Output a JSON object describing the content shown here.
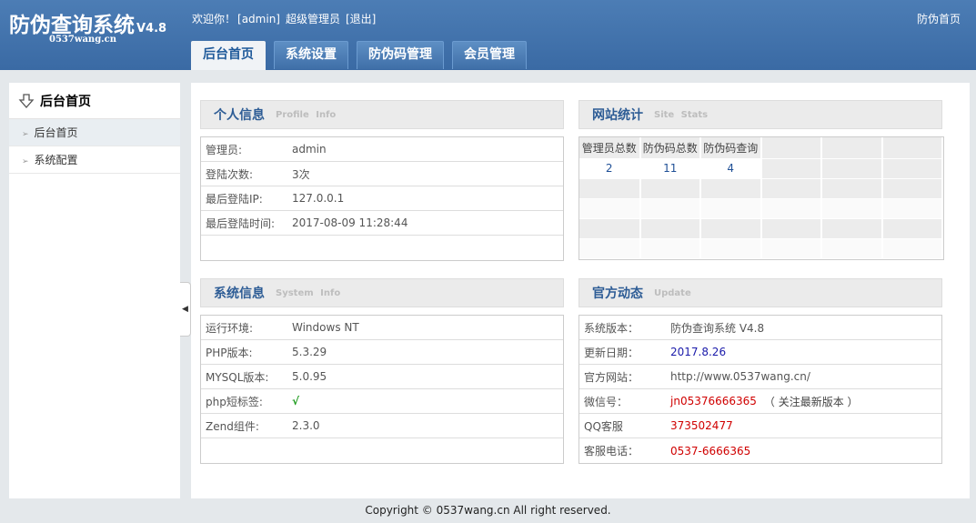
{
  "header": {
    "logo_title": "防伪查询系统",
    "logo_version": "V4.8",
    "logo_subtitle": "0537wang.cn",
    "welcome": "欢迎你！",
    "user": "[admin]",
    "role": "超级管理员",
    "logout": "[退出]",
    "home_link": "防伪首页"
  },
  "nav": {
    "tabs": [
      {
        "label": "后台首页"
      },
      {
        "label": "系统设置"
      },
      {
        "label": "防伪码管理"
      },
      {
        "label": "会员管理"
      }
    ]
  },
  "sidebar": {
    "title": "后台首页",
    "items": [
      {
        "label": "后台首页"
      },
      {
        "label": "系统配置"
      }
    ]
  },
  "profile": {
    "title": "个人信息",
    "subtitle": "Profile  Info",
    "rows": [
      {
        "k": "管理员:",
        "v": "admin"
      },
      {
        "k": "登陆次数:",
        "v": "3次"
      },
      {
        "k": "最后登陆IP:",
        "v": "127.0.0.1"
      },
      {
        "k": "最后登陆时间:",
        "v": "2017-08-09 11:28:44"
      }
    ]
  },
  "stats": {
    "title": "网站统计",
    "subtitle": "Site  Stats",
    "headers": [
      "管理员总数",
      "防伪码总数",
      "防伪码查询"
    ],
    "values": [
      "2",
      "11",
      "4"
    ]
  },
  "sysinfo": {
    "title": "系统信息",
    "subtitle": "System  Info",
    "rows": [
      {
        "k": "运行环境:",
        "v": "Windows NT"
      },
      {
        "k": "PHP版本:",
        "v": "5.3.29"
      },
      {
        "k": "MYSQL版本:",
        "v": "5.0.95"
      },
      {
        "k": "php短标签:",
        "v": "√"
      },
      {
        "k": "Zend组件:",
        "v": "2.3.0"
      }
    ]
  },
  "update": {
    "title": "官方动态",
    "subtitle": "Update",
    "rows": [
      {
        "k": "系统版本：",
        "v": "防伪查询系统 V4.8"
      },
      {
        "k": "更新日期：",
        "v": "2017.8.26"
      },
      {
        "k": "官方网站：",
        "v": "http://www.0537wang.cn/"
      },
      {
        "k": "微信号：",
        "v": "jn05376666365",
        "note": "（ 关注最新版本 ）"
      },
      {
        "k": "QQ客服",
        "v": "373502477"
      },
      {
        "k": "客服电话：",
        "v": "0537-6666365"
      }
    ]
  },
  "footer": {
    "text": "Copyright © 0537wang.cn All right reserved."
  },
  "colors": {
    "header_blue": "#3f6fa8",
    "title_blue": "#2d5c95",
    "value_red": "#d00000",
    "value_blue": "#1a1aaa",
    "check_green": "#1a9a1a"
  }
}
